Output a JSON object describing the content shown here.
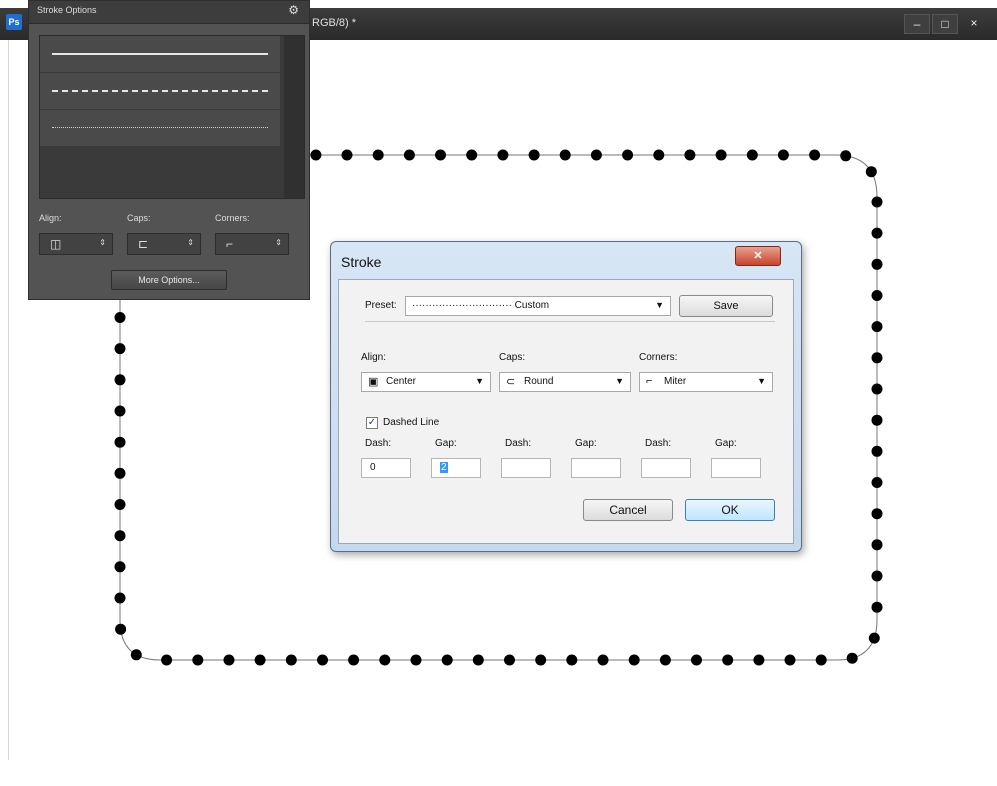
{
  "app": {
    "logo_text": "Ps",
    "document_title": "RGB/8) *",
    "window_controls": {
      "minimize": "–",
      "maximize": "□",
      "close": "×"
    }
  },
  "stroke_options_panel": {
    "title": "Stroke Options",
    "gear_icon": "⚙",
    "presets": [
      "solid",
      "dashed",
      "dotted"
    ],
    "align_label": "Align:",
    "caps_label": "Caps:",
    "corners_label": "Corners:",
    "align_icon": "◫",
    "caps_icon": "⊏",
    "corners_icon": "⌐",
    "more_options_label": "More Options..."
  },
  "stroke_dialog": {
    "title": "Stroke",
    "close_icon": "✕",
    "preset_label": "Preset:",
    "preset_value": "······························ Custom",
    "save_label": "Save",
    "align_label": "Align:",
    "caps_label": "Caps:",
    "corners_label": "Corners:",
    "align_value": "Center",
    "caps_value": "Round",
    "corners_value": "Miter",
    "dashed_line_label": "Dashed Line",
    "dashed_line_checked": true,
    "dash_gap_headers": [
      "Dash:",
      "Gap:",
      "Dash:",
      "Gap:",
      "Dash:",
      "Gap:"
    ],
    "dash_gap_values": [
      "0",
      "2",
      "",
      "",
      "",
      ""
    ],
    "cancel_label": "Cancel",
    "ok_label": "OK"
  }
}
